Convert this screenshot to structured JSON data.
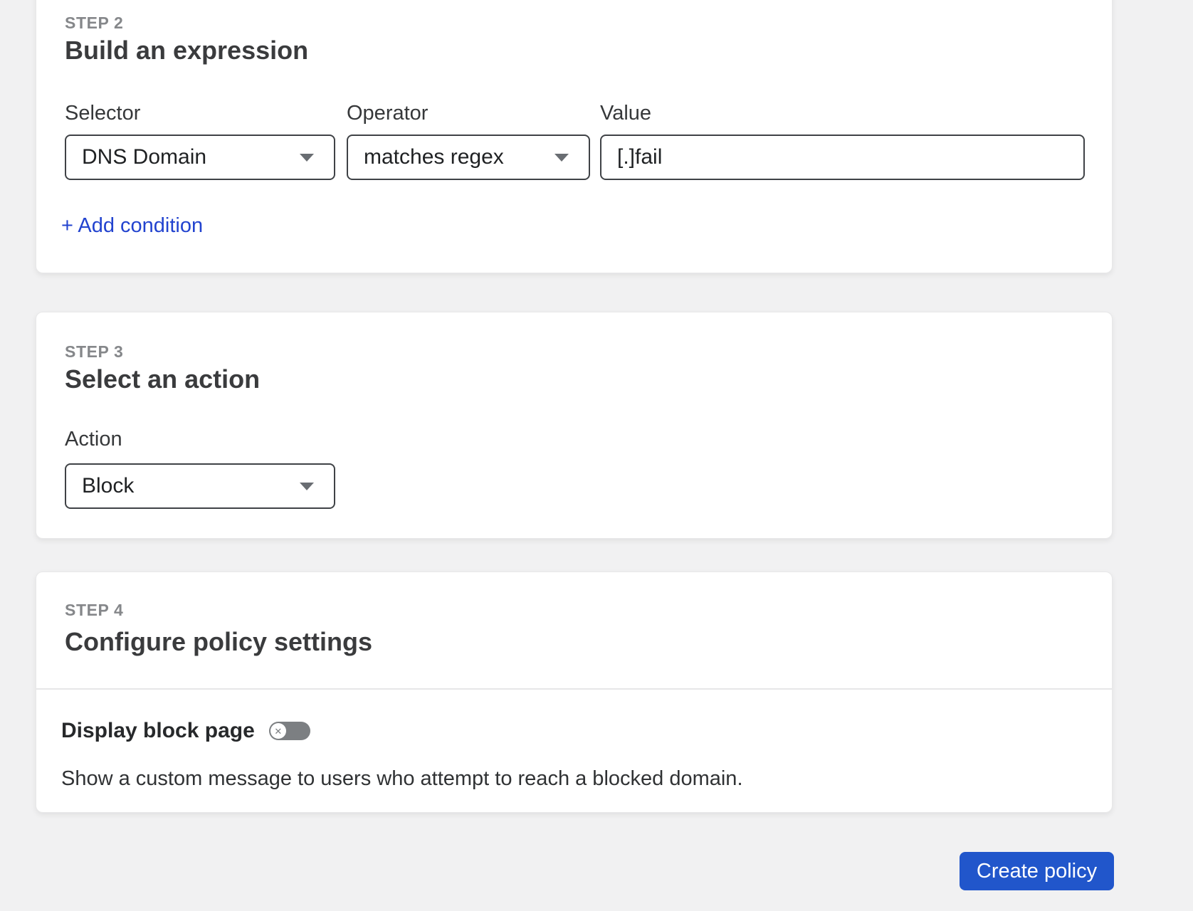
{
  "colors": {
    "page_background": "#f1f1f2",
    "card_background": "#ffffff",
    "link_blue": "#2243cf",
    "button_blue": "#2156cb",
    "step_label_gray": "#85878a",
    "heading_dark": "#3a3b3d",
    "field_border_dark": "#3f4246",
    "toggle_off_gray": "#7c7f82"
  },
  "steps": {
    "step2": {
      "label": "STEP 2",
      "title": "Build an expression",
      "fields": [
        {
          "label": "Selector",
          "value": "DNS Domain",
          "type": "select"
        },
        {
          "label": "Operator",
          "value": "matches regex",
          "type": "select"
        },
        {
          "label": "Value",
          "value": "[.]fail",
          "type": "text-input"
        }
      ],
      "add_condition_label": "+ Add condition"
    },
    "step3": {
      "label": "STEP 3",
      "title": "Select an action",
      "action_label": "Action",
      "action_value": "Block"
    },
    "step4": {
      "label": "STEP 4",
      "title": "Configure policy settings",
      "toggle_label": "Display block page",
      "toggle_state": "off",
      "toggle_off_glyph": "✕",
      "description": "Show a custom message to users who attempt to reach a blocked domain."
    }
  },
  "footer": {
    "create_button_label": "Create policy"
  }
}
